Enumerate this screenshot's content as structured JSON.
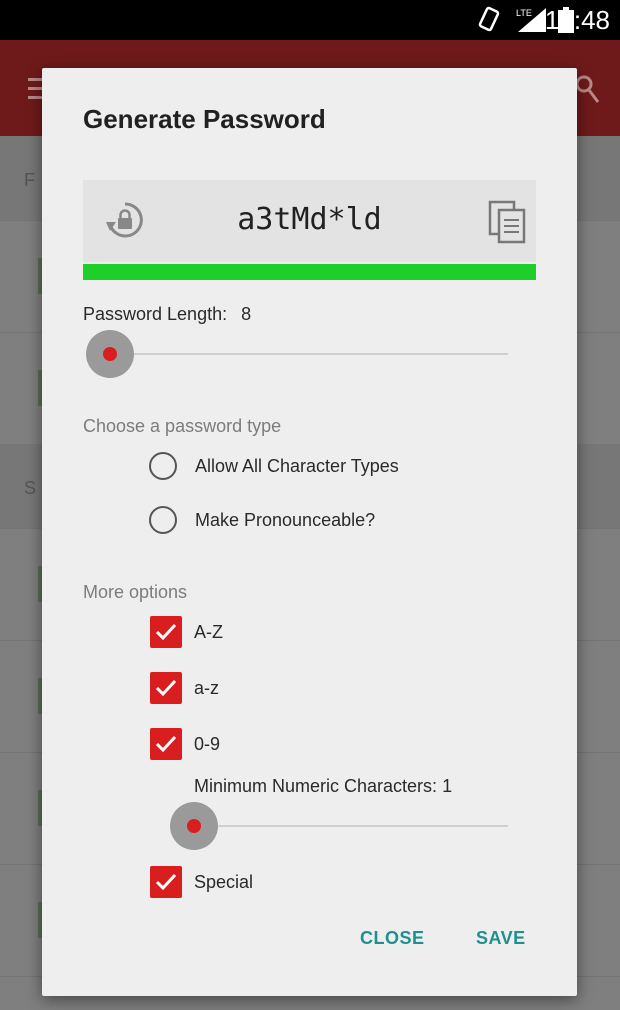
{
  "status_bar": {
    "time": "12:48",
    "network": "LTE"
  },
  "background_app": {
    "bar_color": "#6f1a1a",
    "header_letters": [
      "F",
      "S"
    ]
  },
  "dialog": {
    "title": "Generate Password",
    "password": "a3tMd*ld",
    "strength_color": "#1ecf2a",
    "strength_fraction": 1.0,
    "length": {
      "label": "Password Length:",
      "value": "8"
    },
    "password_type": {
      "label": "Choose a password type",
      "options": [
        {
          "label": "Allow All Character Types",
          "selected": true
        },
        {
          "label": "Make Pronounceable?",
          "selected": false
        }
      ]
    },
    "more_options": {
      "label": "More options",
      "checks": [
        {
          "label": "A-Z",
          "checked": true
        },
        {
          "label": "a-z",
          "checked": true
        },
        {
          "label": "0-9",
          "checked": true
        },
        {
          "label": "Special",
          "checked": true
        }
      ],
      "min_numeric": {
        "label": "Minimum Numeric Characters:",
        "value": "1"
      }
    },
    "buttons": {
      "close": "CLOSE",
      "save": "SAVE"
    },
    "accent_color": "#d81e1e",
    "button_color": "#1f8f8f"
  }
}
